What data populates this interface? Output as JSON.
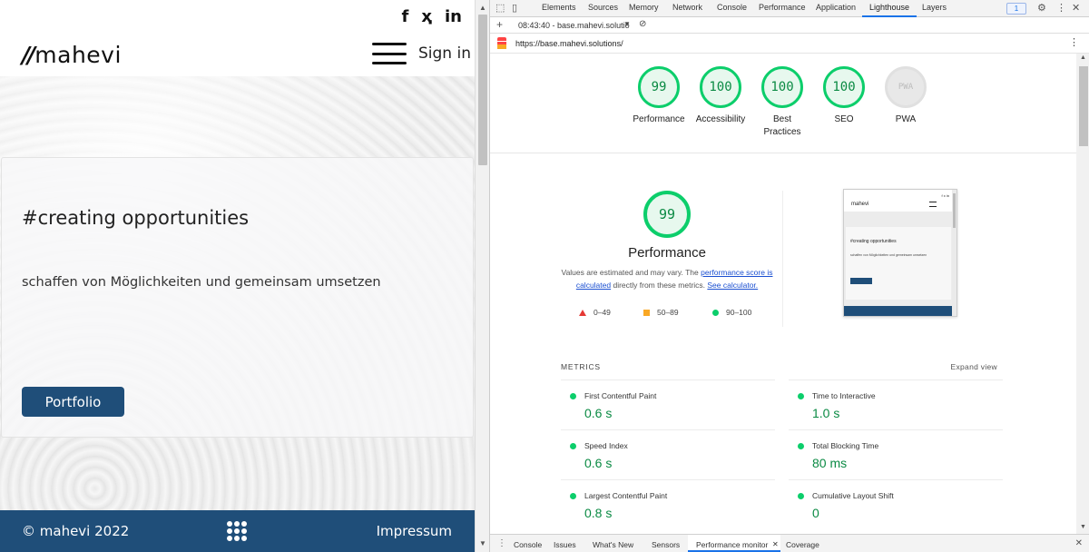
{
  "website": {
    "social": {
      "facebook": "f",
      "xing": "ҳ",
      "linkedin": "in"
    },
    "logo_mark": "//",
    "logo_text": "mahevi",
    "sign_in": "Sign in",
    "hero_title": "#creating opportunities",
    "hero_subtitle": "schaffen von Möglichkeiten und gemeinsam umsetzen",
    "portfolio_button": "Portfolio",
    "footer": {
      "copyright": "© mahevi 2022",
      "impressum": "Impressum"
    }
  },
  "devtools": {
    "tabs": [
      "Elements",
      "Sources",
      "Memory",
      "Network",
      "Console",
      "Performance",
      "Application",
      "Lighthouse",
      "Layers"
    ],
    "active_tab": "Lighthouse",
    "issues_badge": "1",
    "report_selector": "08:43:40 - base.mahevi.solutio",
    "url": "https://base.mahevi.solutions/",
    "gauges": [
      {
        "score": "99",
        "label": "Performance"
      },
      {
        "score": "100",
        "label": "Accessibility"
      },
      {
        "score": "100",
        "label": "Best Practices"
      },
      {
        "score": "100",
        "label": "SEO"
      },
      {
        "score": "PWA",
        "label": "PWA"
      }
    ],
    "performance": {
      "score": "99",
      "title": "Performance",
      "note_prefix": "Values are estimated and may vary. The ",
      "note_link1": "performance score is calculated",
      "note_mid": " directly from these metrics. ",
      "note_link2": "See calculator."
    },
    "legend": {
      "fail": "0–49",
      "average": "50–89",
      "pass": "90–100"
    },
    "preview": {
      "logo": "mahevi",
      "title": "#creating opportunities",
      "subtitle": "schaffen von Möglichkeiten und gemeinsam umsetzen"
    },
    "metrics_heading": "METRICS",
    "expand_view": "Expand view",
    "metrics": [
      {
        "name": "First Contentful Paint",
        "value": "0.6 s"
      },
      {
        "name": "Time to Interactive",
        "value": "1.0 s"
      },
      {
        "name": "Speed Index",
        "value": "0.6 s"
      },
      {
        "name": "Total Blocking Time",
        "value": "80 ms"
      },
      {
        "name": "Largest Contentful Paint",
        "value": "0.8 s"
      },
      {
        "name": "Cumulative Layout Shift",
        "value": "0"
      }
    ],
    "drawer_tabs": [
      "Console",
      "Issues",
      "What's New",
      "Sensors",
      "Performance monitor",
      "Coverage"
    ],
    "drawer_active": "Performance monitor",
    "colors": {
      "pass": "#0cce6b",
      "average": "#f9a825",
      "fail": "#e53935",
      "brand": "#1f4e79"
    }
  }
}
